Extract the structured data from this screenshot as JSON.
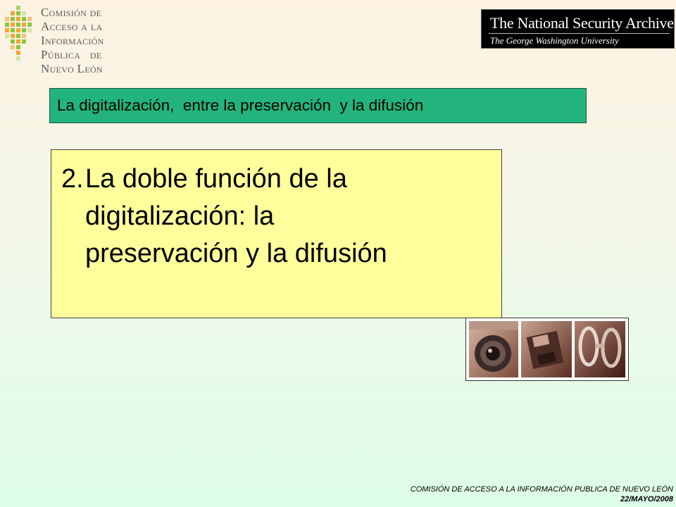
{
  "logo": {
    "lines": [
      "Comisión de",
      "Acceso a la",
      "Información",
      "Pública   de",
      "Nuevo León"
    ]
  },
  "nsa_banner": {
    "title": "The National Security Archive",
    "subtitle": "The George Washington University"
  },
  "slide": {
    "subtitle": "La digitalización,  entre la preservación  y la difusión",
    "heading_number": "2.",
    "heading_lines": [
      "La doble función de la",
      "digitalización: la",
      "preservación y la difusión"
    ]
  },
  "photo": {
    "icon": "camera-floppy-handcuffs-photo"
  },
  "footer": {
    "organization": "COMISIÓN DE ACCESO A LA INFORMACIÓN PUBLICA DE NUEVO LEÓN",
    "date": "22/MAYO/2008"
  },
  "colors": {
    "subtitle_bar": "#22b47c",
    "main_box": "#ffff9c",
    "logo_green": "#8cc63f",
    "logo_orange": "#f4a436"
  }
}
